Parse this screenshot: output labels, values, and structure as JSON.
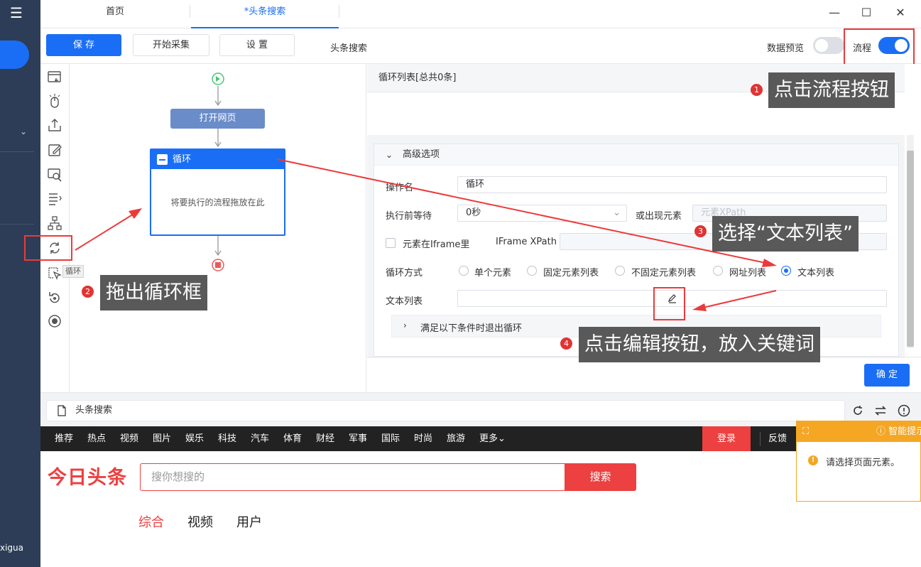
{
  "tabs": [
    {
      "label": "首页",
      "active": false
    },
    {
      "label": "*头条搜索",
      "active": true
    }
  ],
  "toolbar": {
    "save_label": "保 存",
    "start_label": "开始采集",
    "settings_label": "设 置",
    "task_name": "头条搜索",
    "preview_label": "数据预览",
    "preview_on": false,
    "flow_label": "流程",
    "flow_on": true
  },
  "flow": {
    "open_page": "打开网页",
    "loop_title": "循环",
    "loop_placeholder": "将要执行的流程拖放在此",
    "tool_tooltip": "循环"
  },
  "panel": {
    "list_title": "循环列表[总共0条]",
    "advanced_title": "高级选项",
    "op_name_label": "操作名",
    "op_name_value": "循环",
    "wait_label": "执行前等待",
    "wait_value": "0秒",
    "or_appear_label": "或出现元素",
    "or_appear_placeholder": "元素XPath",
    "iframe_label": "元素在Iframe里",
    "iframe_xpath_label": "IFrame XPath",
    "loop_mode_label": "循环方式",
    "loop_modes": [
      {
        "label": "单个元素",
        "selected": false
      },
      {
        "label": "固定元素列表",
        "selected": false
      },
      {
        "label": "不固定元素列表",
        "selected": false
      },
      {
        "label": "网址列表",
        "selected": false
      },
      {
        "label": "文本列表",
        "selected": true
      }
    ],
    "text_list_label": "文本列表",
    "exit_condition_label": "满足以下条件时退出循环",
    "confirm_label": "确 定"
  },
  "browser": {
    "url_title": "头条搜索",
    "nav_items": [
      "推荐",
      "热点",
      "视频",
      "图片",
      "娱乐",
      "科技",
      "汽车",
      "体育",
      "财经",
      "军事",
      "国际",
      "时尚",
      "旅游",
      "更多"
    ],
    "login_label": "登录",
    "feedback_label": "反馈",
    "logo": "今日头条",
    "search_placeholder": "搜你想搜的",
    "search_button": "搜索",
    "tabs": [
      "综合",
      "视频",
      "用户"
    ]
  },
  "smart_prompt": {
    "title": "智能提示",
    "message": "请选择页面元素。"
  },
  "left_footer": "xigua",
  "annotations": [
    {
      "num": "1",
      "text": "点击流程按钮"
    },
    {
      "num": "2",
      "text": "拖出循环框"
    },
    {
      "num": "3",
      "text": "选择“文本列表”"
    },
    {
      "num": "4",
      "text": "点击编辑按钮，放入关键词"
    }
  ],
  "colors": {
    "accent": "#1a6ef5",
    "danger": "#ed4040",
    "annotation": "#595959",
    "warning": "#f5a623"
  }
}
